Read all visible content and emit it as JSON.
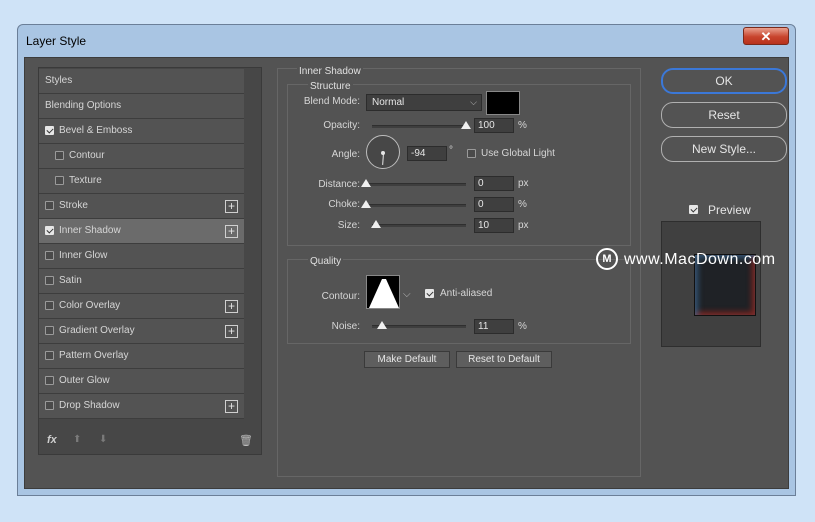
{
  "window": {
    "title": "Layer Style",
    "close_icon": "close-icon"
  },
  "styles_list": {
    "items": [
      {
        "label": "Styles",
        "checkbox": null,
        "checked": false,
        "indent": false,
        "plus": false,
        "active": false
      },
      {
        "label": "Blending Options",
        "checkbox": null,
        "checked": false,
        "indent": false,
        "plus": false,
        "active": false
      },
      {
        "label": "Bevel & Emboss",
        "checkbox": true,
        "checked": true,
        "indent": false,
        "plus": false,
        "active": false
      },
      {
        "label": "Contour",
        "checkbox": true,
        "checked": false,
        "indent": true,
        "plus": false,
        "active": false
      },
      {
        "label": "Texture",
        "checkbox": true,
        "checked": false,
        "indent": true,
        "plus": false,
        "active": false
      },
      {
        "label": "Stroke",
        "checkbox": true,
        "checked": false,
        "indent": false,
        "plus": true,
        "active": false
      },
      {
        "label": "Inner Shadow",
        "checkbox": true,
        "checked": true,
        "indent": false,
        "plus": true,
        "active": true
      },
      {
        "label": "Inner Glow",
        "checkbox": true,
        "checked": false,
        "indent": false,
        "plus": false,
        "active": false
      },
      {
        "label": "Satin",
        "checkbox": true,
        "checked": false,
        "indent": false,
        "plus": false,
        "active": false
      },
      {
        "label": "Color Overlay",
        "checkbox": true,
        "checked": false,
        "indent": false,
        "plus": true,
        "active": false
      },
      {
        "label": "Gradient Overlay",
        "checkbox": true,
        "checked": false,
        "indent": false,
        "plus": true,
        "active": false
      },
      {
        "label": "Pattern Overlay",
        "checkbox": true,
        "checked": false,
        "indent": false,
        "plus": false,
        "active": false
      },
      {
        "label": "Outer Glow",
        "checkbox": true,
        "checked": false,
        "indent": false,
        "plus": false,
        "active": false
      },
      {
        "label": "Drop Shadow",
        "checkbox": true,
        "checked": false,
        "indent": false,
        "plus": true,
        "active": false
      }
    ],
    "footer": {
      "fx_label": "fx",
      "up_icon": "arrow-up-icon",
      "down_icon": "arrow-down-icon",
      "trash_icon": "trash-icon"
    }
  },
  "inner_shadow": {
    "title": "Inner Shadow",
    "structure": {
      "title": "Structure",
      "blend_mode_label": "Blend Mode:",
      "blend_mode_value": "Normal",
      "blend_color": "#000000",
      "opacity_label": "Opacity:",
      "opacity_value": "100",
      "opacity_unit": "%",
      "opacity_level": 1.0,
      "angle_label": "Angle:",
      "angle_value": "-94",
      "angle_unit": "°",
      "use_global_light_label": "Use Global Light",
      "use_global_light_checked": false,
      "distance_label": "Distance:",
      "distance_value": "0",
      "distance_unit": "px",
      "distance_level": 0,
      "choke_label": "Choke:",
      "choke_value": "0",
      "choke_unit": "%",
      "choke_level": 0,
      "size_label": "Size:",
      "size_value": "10",
      "size_unit": "px",
      "size_level": 0.04
    },
    "quality": {
      "title": "Quality",
      "contour_label": "Contour:",
      "anti_aliased_label": "Anti-aliased",
      "anti_aliased_checked": true,
      "noise_label": "Noise:",
      "noise_value": "11",
      "noise_unit": "%",
      "noise_level": 0.11
    },
    "make_default_label": "Make Default",
    "reset_default_label": "Reset to Default"
  },
  "buttons": {
    "ok": "OK",
    "reset": "Reset",
    "new_style": "New Style..."
  },
  "preview": {
    "label": "Preview",
    "checked": true
  },
  "watermark": {
    "logo": "M",
    "text": "www.MacDown.com"
  }
}
